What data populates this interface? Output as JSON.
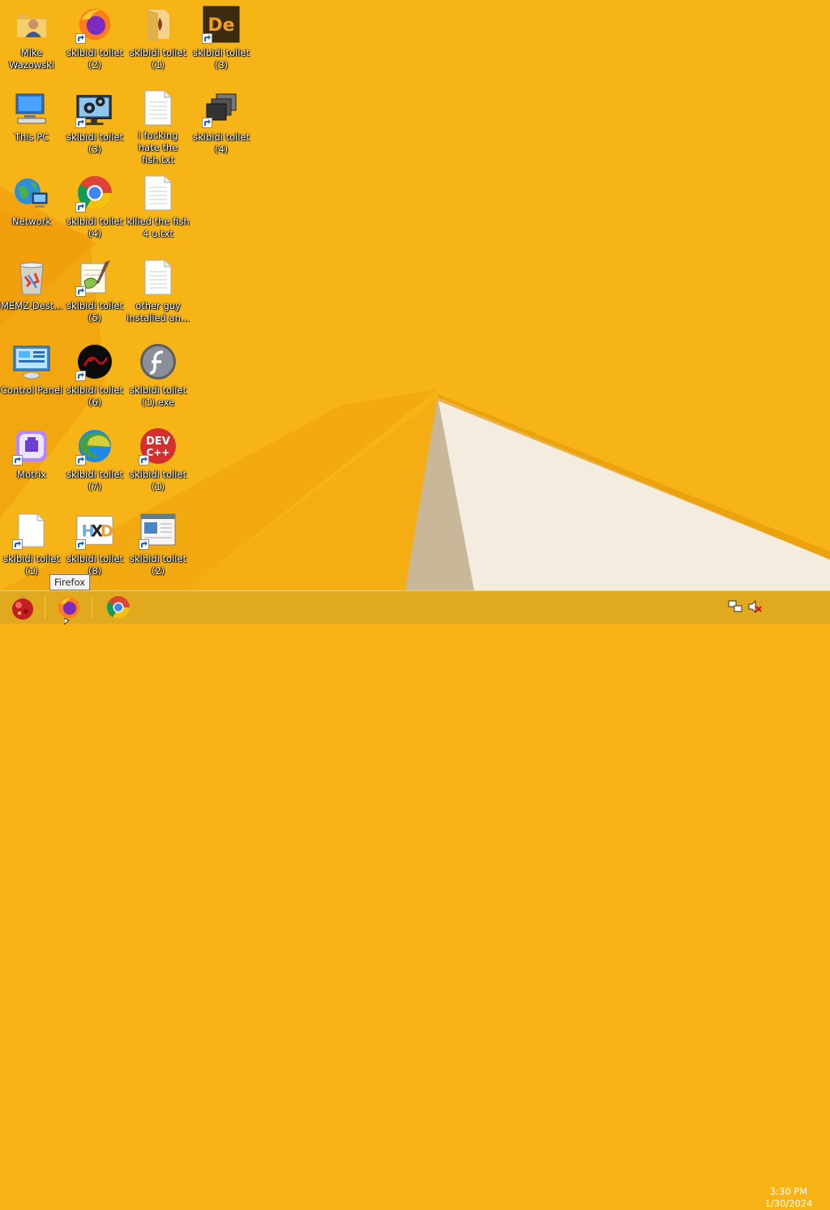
{
  "desktop": {
    "icons": [
      {
        "label": "Mike Wazowski",
        "icon": "folder-user-icon"
      },
      {
        "label": "skibidi toilet (2)",
        "icon": "firefox-icon"
      },
      {
        "label": "skibidi toilet (1)",
        "icon": "folder-media-icon"
      },
      {
        "label": "skibidi toilet (3)",
        "icon": "devexpress-icon"
      },
      {
        "label": "This PC",
        "icon": "computer-icon"
      },
      {
        "label": "skibidi toilet (3)",
        "icon": "monitor-gears-icon"
      },
      {
        "label": "i fucking hate the fish.txt",
        "icon": "text-file-icon"
      },
      {
        "label": "skibidi toilet (4)",
        "icon": "windows-stack-icon"
      },
      {
        "label": "Network",
        "icon": "network-globe-icon"
      },
      {
        "label": "skibidi toilet (4)",
        "icon": "chrome-icon"
      },
      {
        "label": "killed the fish 4 u.txt",
        "icon": "text-file-icon"
      },
      {
        "label": "MEMZ-Dest...",
        "icon": "recycle-bin-icon"
      },
      {
        "label": "skibidi toilet (5)",
        "icon": "notepadpp-icon"
      },
      {
        "label": "other guy installed an...",
        "icon": "text-file-icon"
      },
      {
        "label": "Control Panel",
        "icon": "control-panel-icon"
      },
      {
        "label": "skibidi toilet (6)",
        "icon": "dark-circle-app-icon"
      },
      {
        "label": "skibidi toilet (1).exe",
        "icon": "flash-player-icon"
      },
      {
        "label": "Motrix",
        "icon": "motrix-icon"
      },
      {
        "label": "skibidi toilet (7)",
        "icon": "edge-icon"
      },
      {
        "label": "skibidi toilet (1)",
        "icon": "dev-cpp-icon"
      },
      {
        "label": "skibidi toilet (1)",
        "icon": "blank-document-icon"
      },
      {
        "label": "skibidi toilet (8)",
        "icon": "hxd-icon"
      },
      {
        "label": "skibidi toilet (2)",
        "icon": "window-app-icon"
      }
    ]
  },
  "taskbar": {
    "start_icon": "ornament-start-icon",
    "pinned": [
      {
        "name": "firefox",
        "icon": "firefox-icon"
      },
      {
        "name": "chrome",
        "icon": "chrome-icon"
      }
    ],
    "tooltip": "Firefox",
    "clock": {
      "time": "3:30 PM",
      "date": "1/30/2024"
    },
    "tray": [
      {
        "icon": "network-icon"
      },
      {
        "icon": "volume-muted-icon"
      }
    ]
  },
  "colors": {
    "wallpaper": "#f6b313",
    "taskbar": "#dea81e"
  }
}
